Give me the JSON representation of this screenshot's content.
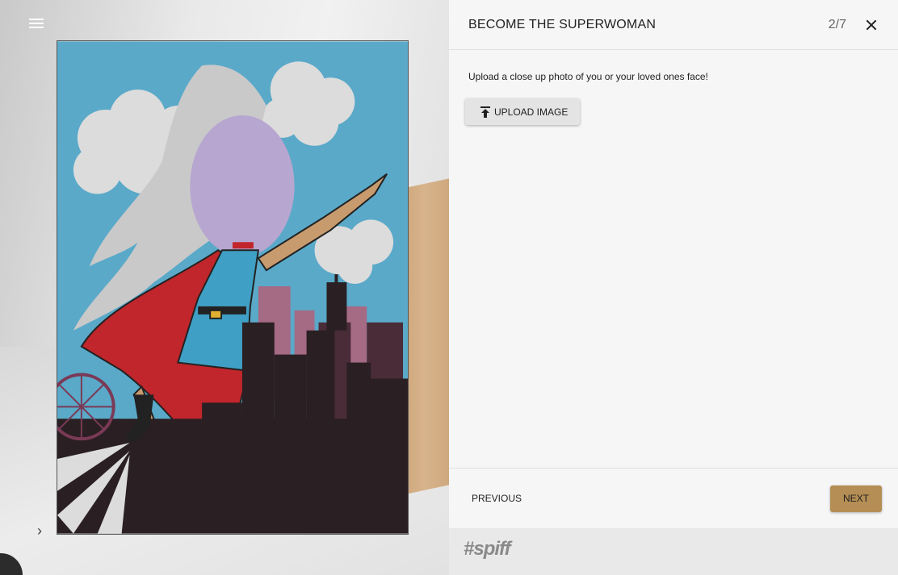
{
  "header": {
    "title": "BECOME THE SUPERWOMAN",
    "step": "2/7"
  },
  "body": {
    "instruction": "Upload a close up photo of you or your loved ones face!",
    "upload_label": "UPLOAD IMAGE"
  },
  "footer": {
    "previous_label": "PREVIOUS",
    "next_label": "NEXT"
  },
  "brand": {
    "text": "#spiff"
  },
  "icons": {
    "menu": "menu-icon",
    "close": "close-icon",
    "upload": "upload-icon",
    "expand": "chevron-right-icon"
  },
  "colors": {
    "accent": "#b58e55",
    "sky": "#5aa9c9",
    "cape": "#c0262b",
    "dress": "#3f9fc4",
    "skyline": "#2a1f22",
    "face_placeholder": "#b7a6cf"
  }
}
